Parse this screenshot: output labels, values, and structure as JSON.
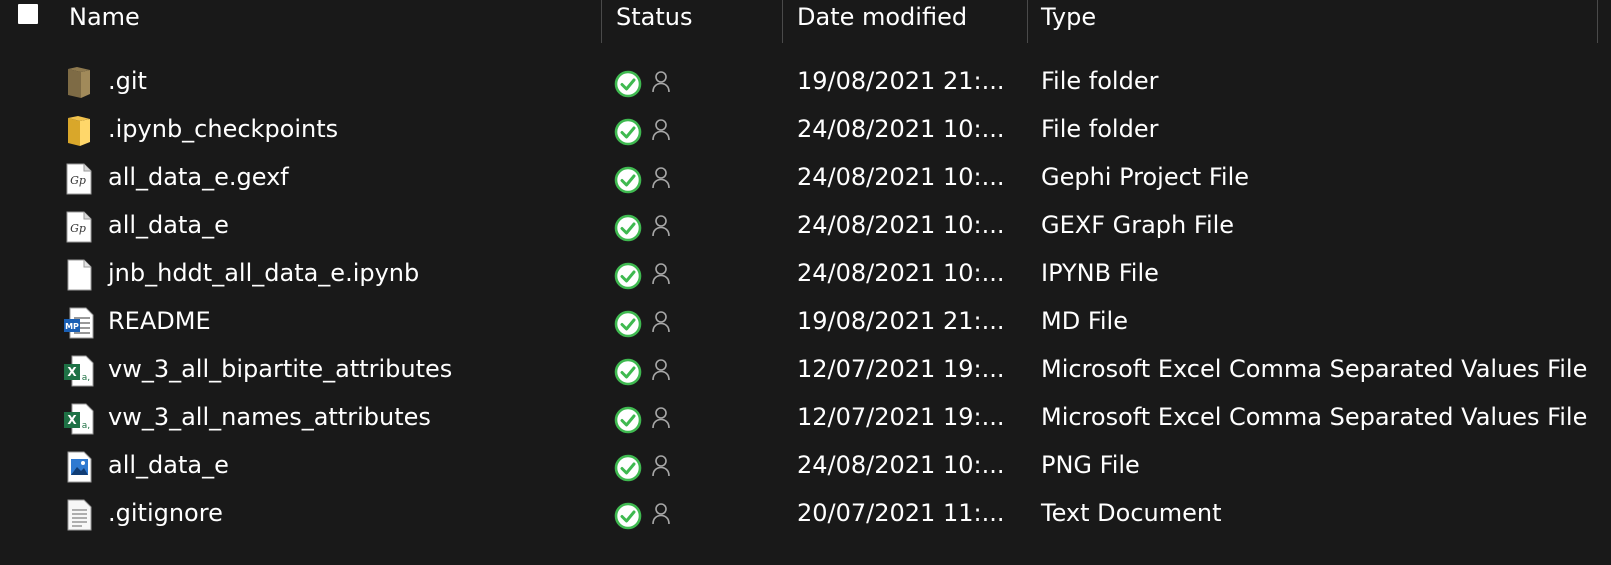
{
  "columns": {
    "name": "Name",
    "status": "Status",
    "date": "Date modified",
    "type": "Type"
  },
  "files": [
    {
      "name": ".git",
      "icon": "folder-dark-icon",
      "status": "synced",
      "date": "19/08/2021 21:...",
      "type": "File folder"
    },
    {
      "name": ".ipynb_checkpoints",
      "icon": "folder-icon",
      "status": "synced",
      "date": "24/08/2021 10:...",
      "type": "File folder"
    },
    {
      "name": "all_data_e.gexf",
      "icon": "gephi-icon",
      "status": "synced",
      "date": "24/08/2021 10:...",
      "type": "Gephi Project File"
    },
    {
      "name": "all_data_e",
      "icon": "gephi-icon",
      "status": "synced",
      "date": "24/08/2021 10:...",
      "type": "GEXF Graph File"
    },
    {
      "name": "jnb_hddt_all_data_e.ipynb",
      "icon": "blank-file-icon",
      "status": "synced",
      "date": "24/08/2021 10:...",
      "type": "IPYNB File"
    },
    {
      "name": "README",
      "icon": "markdown-file-icon",
      "status": "synced",
      "date": "19/08/2021 21:...",
      "type": "MD File"
    },
    {
      "name": "vw_3_all_bipartite_attributes",
      "icon": "excel-csv-icon",
      "status": "synced",
      "date": "12/07/2021 19:...",
      "type": "Microsoft Excel Comma Separated Values File"
    },
    {
      "name": "vw_3_all_names_attributes",
      "icon": "excel-csv-icon",
      "status": "synced",
      "date": "12/07/2021 19:...",
      "type": "Microsoft Excel Comma Separated Values File"
    },
    {
      "name": "all_data_e",
      "icon": "image-file-icon",
      "status": "synced",
      "date": "24/08/2021 10:...",
      "type": "PNG File"
    },
    {
      "name": ".gitignore",
      "icon": "text-file-icon",
      "status": "synced",
      "date": "20/07/2021 11:...",
      "type": "Text Document"
    }
  ],
  "icon_labels": {
    "markdown": "MP",
    "excel": "X",
    "gephi": "Gp"
  },
  "colors": {
    "background": "#191919",
    "text": "#ffffff",
    "sync_green": "#3fb950",
    "divider": "#4a4a4a"
  }
}
